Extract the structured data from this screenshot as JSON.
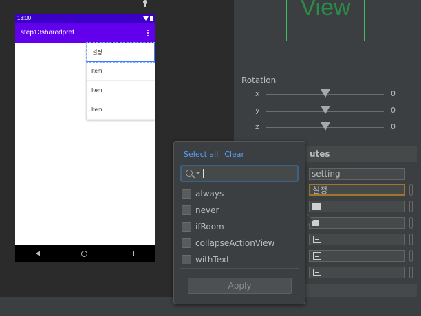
{
  "phone": {
    "status_time": "13:00",
    "app_title": "step13sharedpref",
    "menu_items": [
      "설정",
      "Item",
      "Item",
      "Item"
    ]
  },
  "canvas": {
    "view_label": "View"
  },
  "rotation": {
    "title": "Rotation",
    "axes": [
      {
        "label": "x",
        "value": "0",
        "level": 0.5
      },
      {
        "label": "y",
        "value": "0",
        "level": 0.5
      },
      {
        "label": "z",
        "value": "0",
        "level": 0.5
      }
    ]
  },
  "attributes": {
    "title": "utes",
    "id_value": "setting",
    "title_value": "설정"
  },
  "popup": {
    "select_all": "Select all",
    "clear": "Clear",
    "search_value": "",
    "options": [
      "always",
      "never",
      "ifRoom",
      "collapseActionView",
      "withText"
    ],
    "apply_label": "Apply"
  },
  "colors": {
    "status_bar": "#3a00c8",
    "app_bar": "#6200ee",
    "link": "#589df6",
    "view_outline": "#3fbf5f",
    "warning_border": "#a1752c"
  }
}
